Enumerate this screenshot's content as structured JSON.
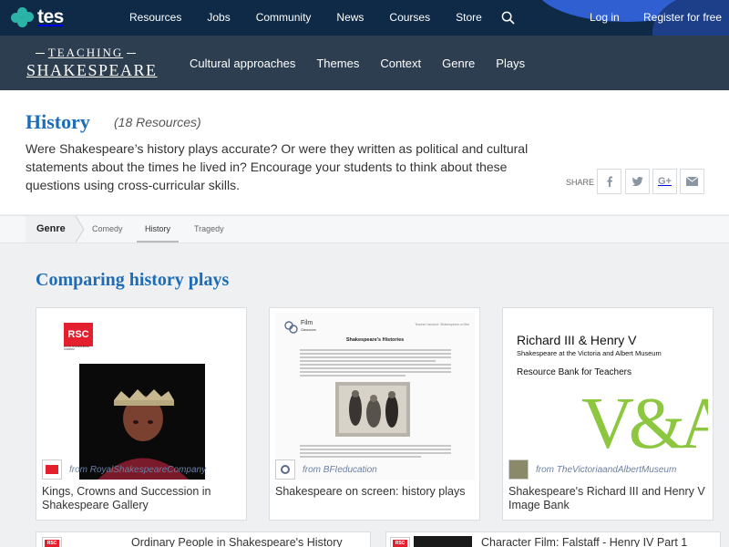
{
  "topbar": {
    "logo": "tes",
    "nav": [
      "Resources",
      "Jobs",
      "Community",
      "News",
      "Courses",
      "Store"
    ],
    "login": "Log in",
    "register": "Register for free"
  },
  "subbar": {
    "brand_top": "TEACHING",
    "brand_bottom": "SHAKESPEARE",
    "nav": [
      "Cultural approaches",
      "Themes",
      "Context",
      "Genre",
      "Plays"
    ]
  },
  "header": {
    "title": "History",
    "resource_count": "(18 Resources)",
    "description": "Were Shakespeare’s history plays accurate? Or were they written as political and cultural statements about the times he lived in? Encourage your students to think about these questions using cross-curricular skills.",
    "share_label": "SHARE",
    "share_buttons": [
      "facebook-icon",
      "twitter-icon",
      "google-plus-icon",
      "email-icon"
    ],
    "gplus_text": "G+"
  },
  "breadcrumb": {
    "root": "Genre",
    "items": [
      "Comedy",
      "History",
      "Tragedy"
    ],
    "active": "History"
  },
  "section": {
    "title": "Comparing history plays"
  },
  "cards": [
    {
      "title": "Kings, Crowns and Succession in Shakespeare Gallery",
      "source": "from RoyalShakespeareCompany",
      "thumb_logo": "RSC",
      "thumb_logo_caption": "ROYAL SHAKESPEARE COMPANY"
    },
    {
      "title": "Shakespeare on screen: history plays",
      "source": "from BFIeducation",
      "thumb_logo": "Film",
      "thumb_logo_sub": "Classroom",
      "thumb_heading": "Shakespeare's Histories",
      "thumb_corner": "Teacher handout: Shakespeare on film"
    },
    {
      "title": "Shakespeare's Richard III and Henry V Image Bank",
      "source": "from TheVictoriaandAlbertMuseum",
      "thumb_line1": "Richard III & Henry V",
      "thumb_line2": "Shakespeare  at the Victoria and Albert Museum",
      "thumb_line3": "Resource Bank for Teachers",
      "thumb_logo": "V&A"
    }
  ],
  "next_cards": [
    {
      "title": "Ordinary People in Shakespeare's History",
      "logo": "RSC"
    },
    {
      "title": "Character Film: Falstaff - Henry IV Part 1",
      "logo": "RSC"
    }
  ],
  "colors": {
    "topbar": "#0e2a47",
    "subbar": "#2c3e4f",
    "accent_blue": "#1e6cb8",
    "rsc_red": "#e4202e",
    "va_green": "#8dc63f",
    "tes_teal": "#2bb3a8"
  }
}
